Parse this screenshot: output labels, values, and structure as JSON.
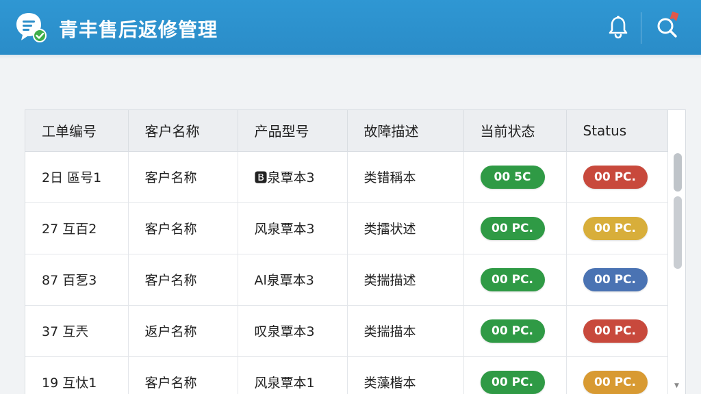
{
  "header": {
    "title": "青丰售后返修管理",
    "logo_icon": "chat-check-logo",
    "notification_icon": "bell-icon",
    "search_icon": "search-icon"
  },
  "table": {
    "columns": [
      "工单编号",
      "客户名称",
      "产品型号",
      "故障描述",
      "当前状态",
      "Status"
    ],
    "rows": [
      {
        "id": "2日 區号1",
        "customer": "客户名称",
        "model": "🅱泉覃本3",
        "fault": "类错稱本",
        "state": "00 5C",
        "state_color": "green",
        "status": "00 PC.",
        "status_color": "red"
      },
      {
        "id": "27 互百2",
        "customer": "客户名称",
        "model": "风泉覃本3",
        "fault": "类擂状述",
        "state": "00 PC.",
        "state_color": "green",
        "status": "00 PC.",
        "status_color": "yellow"
      },
      {
        "id": "87 百乭3",
        "customer": "客户名称",
        "model": "Al泉覃本3",
        "fault": "类揣描述",
        "state": "00 PC.",
        "state_color": "green",
        "status": "00 PC.",
        "status_color": "blue"
      },
      {
        "id": "37 互兲",
        "customer": "返户名称",
        "model": "叹泉覃本3",
        "fault": "类揣描本",
        "state": "00 PC.",
        "state_color": "green",
        "status": "00 PC.",
        "status_color": "red"
      },
      {
        "id": "19 互忲1",
        "customer": "客户名称",
        "model": "风泉覃本1",
        "fault": "类藻楷本",
        "state": "00 PC.",
        "state_color": "green",
        "status": "00 PC.",
        "status_color": "orange"
      }
    ]
  }
}
